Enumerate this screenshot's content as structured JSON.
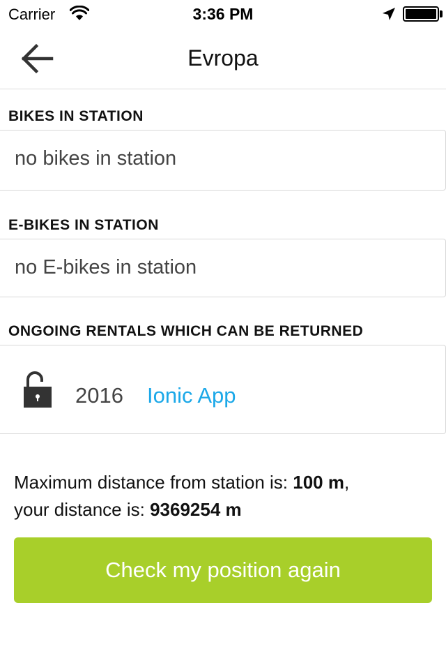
{
  "status_bar": {
    "carrier": "Carrier",
    "time": "3:36 PM"
  },
  "header": {
    "title": "Evropa"
  },
  "sections": {
    "bikes": {
      "title": "BIKES IN STATION",
      "empty_text": "no bikes in station"
    },
    "ebikes": {
      "title": "E-BIKES IN STATION",
      "empty_text": "no E-bikes in station"
    },
    "rentals": {
      "title": "ONGOING RENTALS WHICH CAN BE RETURNED",
      "items": [
        {
          "year": "2016",
          "app": "Ionic App",
          "icon": "unlocked-lock-icon"
        }
      ]
    }
  },
  "distance": {
    "max_label": "Maximum distance from station is: ",
    "max_value": "100 m",
    "max_suffix": ",",
    "your_label": "your distance is: ",
    "your_value": "9369254 m"
  },
  "actions": {
    "check_position_label": "Check my position again"
  },
  "colors": {
    "accent": "#a8cf2a",
    "link": "#1ba8e8"
  }
}
